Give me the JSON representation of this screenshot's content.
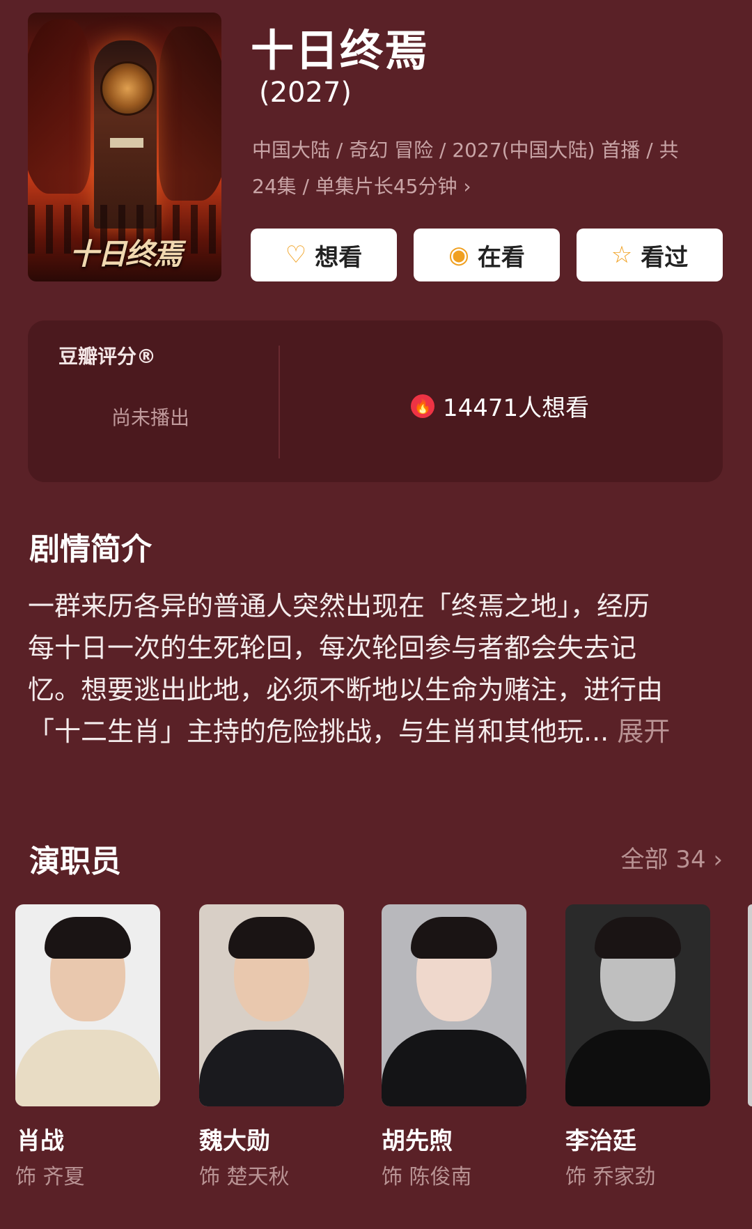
{
  "show": {
    "title": "十日终焉",
    "year": "(2027)",
    "meta_line1": "中国大陆 / 奇幻 冒险 / 2027(中国大陆) 首播 / 共",
    "meta_line2": "24集 / 单集片长45分钟",
    "poster_text": "十日终焉"
  },
  "actions": [
    {
      "label": "想看",
      "icon": "heart-plus-icon"
    },
    {
      "label": "在看",
      "icon": "circle-dot-icon"
    },
    {
      "label": "看过",
      "icon": "star-icon"
    }
  ],
  "rating": {
    "label": "豆瓣评分®",
    "status": "尚未播出",
    "want_count": "14471人想看"
  },
  "synopsis": {
    "heading": "剧情简介",
    "line1": "一群来历各异的普通人突然出现在「终焉之地」，经历",
    "line2": "每十日一次的生死轮回，每次轮回参与者都会失去记",
    "line3": "忆。想要逃出此地，必须不断地以生命为赌注，进行由",
    "line4": "「十二生肖」主持的危险挑战，与生肖和其他玩...",
    "more": " 展开"
  },
  "cast": {
    "heading": "演职员",
    "all_label": "全部 34",
    "members": [
      {
        "name": "肖战",
        "role": "饰 齐夏"
      },
      {
        "name": "魏大勋",
        "role": "饰 楚天秋"
      },
      {
        "name": "胡先煦",
        "role": "饰 陈俊南"
      },
      {
        "name": "李治廷",
        "role": "饰 乔家劲"
      }
    ]
  },
  "colors": {
    "background": "#5a2127",
    "accent_icon": "#f0a020",
    "flame": "#ee3344"
  }
}
